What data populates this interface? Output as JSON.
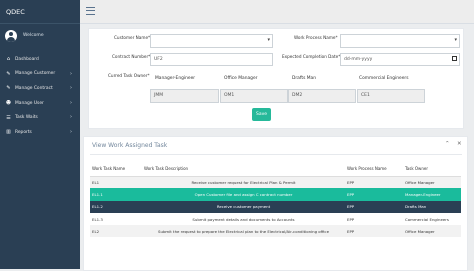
{
  "app": {
    "brand": "QDEC",
    "welcome": "Welcome"
  },
  "sidebar": {
    "items": [
      {
        "label": "Dashboard",
        "icon": "home-icon",
        "chevron": false
      },
      {
        "label": "Manage Customer",
        "icon": "edit-icon",
        "chevron": true
      },
      {
        "label": "Manage Contract",
        "icon": "edit-icon",
        "chevron": true
      },
      {
        "label": "Manage User",
        "icon": "users-icon",
        "chevron": true
      },
      {
        "label": "Task Waits",
        "icon": "tasks-icon",
        "chevron": true
      },
      {
        "label": "Reports",
        "icon": "bar-chart-icon",
        "chevron": true
      }
    ]
  },
  "form": {
    "customer_name_label": "Customer Name*",
    "customer_name_value": "",
    "work_process_label": "Work Process Name*",
    "work_process_value": "",
    "contract_number_label": "Contract Number*",
    "contract_number_value": "UF2",
    "completion_date_label": "Expected Completion Date*",
    "completion_date_value": "dd-mm-yyyy",
    "owner_label": "Curred Task Owner*",
    "owner_headers": [
      "Manager-Engineer",
      "Office Manager",
      "Drafts Man",
      "Commercial Engineers"
    ],
    "owner_values": [
      "JMM",
      "OM1",
      "DM2",
      "CE1"
    ],
    "save_label": "Save"
  },
  "assigned": {
    "title": "View Work Assigned Task",
    "columns": [
      "Work Task Name",
      "Work Task Description",
      "Work Process Name",
      "Task Owner"
    ],
    "rows": [
      {
        "name": "EL1",
        "desc": "Receive customer request for Electrical Plan & Permit",
        "process": "EPP",
        "owner": "Office Manager"
      },
      {
        "name": "EL1.1",
        "desc": "Open Customer file and assign C contract number",
        "process": "EPP",
        "owner": "Manager-Engineer"
      },
      {
        "name": "EL1.2",
        "desc": "Receive customer payment",
        "process": "EPP",
        "owner": "Drafts Man"
      },
      {
        "name": "EL1.3",
        "desc": "Submit payment details and documents to Accounts",
        "process": "EPP",
        "owner": "Commercial Engineers"
      },
      {
        "name": "EL2",
        "desc": "Submit the request to prepare the Electrical plan to the Electrical/Air-conditioning office",
        "process": "EPP",
        "owner": "Office Manager"
      }
    ]
  }
}
